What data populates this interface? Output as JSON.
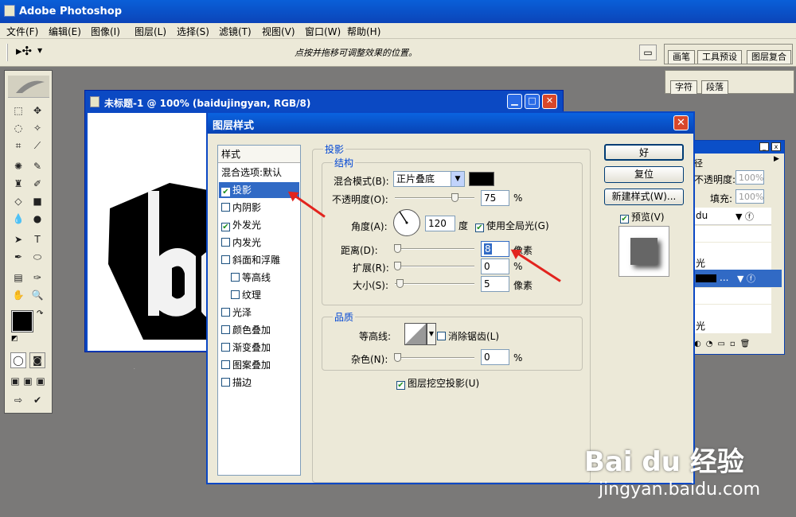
{
  "app": {
    "title": "Adobe Photoshop"
  },
  "menu": [
    "文件(F)",
    "编辑(E)",
    "图像(I)",
    "图层(L)",
    "选择(S)",
    "滤镜(T)",
    "视图(V)",
    "窗口(W)",
    "帮助(H)"
  ],
  "options_bar": {
    "hint": "点按并拖移可调整效果的位置。",
    "tool_icon": "move-tool-icon"
  },
  "palette_well": {
    "tabs_top": [
      "画笔",
      "工具预设",
      "图层复合"
    ],
    "tabs_second": [
      "字符",
      "段落"
    ]
  },
  "document": {
    "title": "未标题-1 @ 100% (baidujingyan, RGB/8)",
    "canvas_text": "ba"
  },
  "layers_panel": {
    "tab_partial": "径",
    "opacity_label": "不透明度:",
    "opacity_value": "100%",
    "fill_label": "填充:",
    "fill_value": "100%",
    "rows": [
      "du",
      "光",
      "",
      "...",
      "光"
    ]
  },
  "dialog": {
    "title": "图层样式",
    "styles_header": "样式",
    "styles": [
      {
        "label": "混合选项:默认",
        "checkbox": false,
        "checked": false,
        "selected": false,
        "indent": false
      },
      {
        "label": "投影",
        "checkbox": true,
        "checked": true,
        "selected": true,
        "indent": false
      },
      {
        "label": "内阴影",
        "checkbox": true,
        "checked": false,
        "selected": false,
        "indent": false
      },
      {
        "label": "外发光",
        "checkbox": true,
        "checked": true,
        "selected": false,
        "indent": false
      },
      {
        "label": "内发光",
        "checkbox": true,
        "checked": false,
        "selected": false,
        "indent": false
      },
      {
        "label": "斜面和浮雕",
        "checkbox": true,
        "checked": false,
        "selected": false,
        "indent": false
      },
      {
        "label": "等高线",
        "checkbox": true,
        "checked": false,
        "selected": false,
        "indent": true
      },
      {
        "label": "纹理",
        "checkbox": true,
        "checked": false,
        "selected": false,
        "indent": true
      },
      {
        "label": "光泽",
        "checkbox": true,
        "checked": false,
        "selected": false,
        "indent": false
      },
      {
        "label": "颜色叠加",
        "checkbox": true,
        "checked": false,
        "selected": false,
        "indent": false
      },
      {
        "label": "渐变叠加",
        "checkbox": true,
        "checked": false,
        "selected": false,
        "indent": false
      },
      {
        "label": "图案叠加",
        "checkbox": true,
        "checked": false,
        "selected": false,
        "indent": false
      },
      {
        "label": "描边",
        "checkbox": true,
        "checked": false,
        "selected": false,
        "indent": false
      }
    ],
    "section_title": "投影",
    "structure": {
      "title": "结构",
      "blend_mode_label": "混合模式(B):",
      "blend_mode_value": "正片叠底",
      "shadow_color": "#000000",
      "opacity_label": "不透明度(O):",
      "opacity_value": "75",
      "opacity_fraction": 0.75,
      "angle_label": "角度(A):",
      "angle_value": "120",
      "angle_unit": "度",
      "global_light_label": "使用全局光(G)",
      "global_light_checked": true,
      "distance_label": "距离(D):",
      "distance_value": "8",
      "distance_unit": "像素",
      "spread_label": "扩展(R):",
      "spread_value": "0",
      "spread_unit": "%",
      "size_label": "大小(S):",
      "size_value": "5",
      "size_unit": "像素",
      "percent": "%"
    },
    "quality": {
      "title": "品质",
      "contour_label": "等高线:",
      "antialias_label": "消除锯齿(L)",
      "antialias_checked": false,
      "noise_label": "杂色(N):",
      "noise_value": "0",
      "noise_unit": "%"
    },
    "knockout_label": "图层挖空投影(U)",
    "knockout_checked": true,
    "buttons": {
      "ok": "好",
      "reset": "复位",
      "new_style": "新建样式(W)...",
      "preview": "预览(V)"
    },
    "preview_checked": true
  },
  "watermark": {
    "brand": "Bai du 经验",
    "url": "jingyan.baidu.com"
  },
  "colors": {
    "titlebar": "#0b4fc8",
    "selection": "#316ac5",
    "annotation_arrow": "#e2241e"
  }
}
